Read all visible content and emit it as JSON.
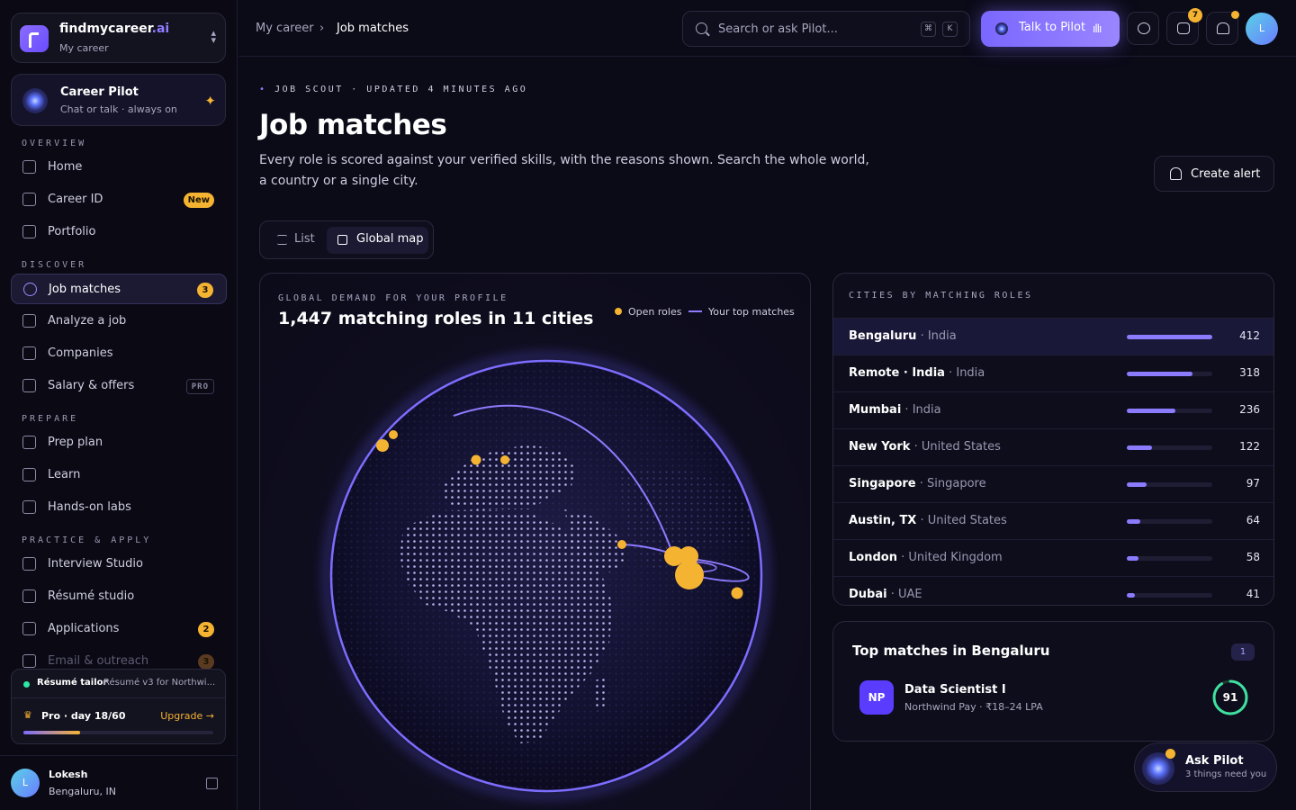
{
  "brand": {
    "name": "findmycareer",
    "suffix": ".ai",
    "subtitle": "My career"
  },
  "pilot_card": {
    "title": "Career Pilot",
    "subtitle": "Chat or talk · always on"
  },
  "sidebar": {
    "sections": [
      {
        "label": "OVERVIEW",
        "items": [
          {
            "label": "Home",
            "icon": "home-icon"
          },
          {
            "label": "Career ID",
            "icon": "id-card-icon",
            "badge": "New"
          },
          {
            "label": "Portfolio",
            "icon": "portfolio-icon"
          }
        ]
      },
      {
        "label": "DISCOVER",
        "items": [
          {
            "label": "Job matches",
            "icon": "target-icon",
            "badge": "3",
            "active": true
          },
          {
            "label": "Analyze a job",
            "icon": "scan-icon"
          },
          {
            "label": "Companies",
            "icon": "building-icon"
          },
          {
            "label": "Salary & offers",
            "icon": "rupee-icon",
            "badge": "PRO"
          }
        ]
      },
      {
        "label": "PREPARE",
        "items": [
          {
            "label": "Prep plan",
            "icon": "route-icon"
          },
          {
            "label": "Learn",
            "icon": "book-icon"
          },
          {
            "label": "Hands-on labs",
            "icon": "flask-icon"
          }
        ]
      },
      {
        "label": "PRACTICE & APPLY",
        "items": [
          {
            "label": "Interview Studio",
            "icon": "mic-icon"
          },
          {
            "label": "Résumé studio",
            "icon": "document-icon"
          },
          {
            "label": "Applications",
            "icon": "kanban-icon",
            "badge": "2"
          },
          {
            "label": "Email & outreach",
            "icon": "mail-icon",
            "badge": "3"
          }
        ]
      }
    ]
  },
  "status_card": {
    "task": "Résumé tailor",
    "detail": "Résumé v3 for Northwi...",
    "plan": "Pro · day 18/60",
    "upgrade": "Upgrade →",
    "progress": 0.3
  },
  "user": {
    "initial": "L",
    "name": "Lokesh",
    "location": "Bengaluru, IN"
  },
  "header": {
    "crumbs": [
      "My career",
      "Job matches"
    ],
    "search_placeholder": "Search or ask Pilot...",
    "kbd": [
      "⌘",
      "K"
    ],
    "talk_label": "Talk to Pilot",
    "messages_badge": "7",
    "avatar_initial": "L"
  },
  "page": {
    "eyebrow": "JOB SCOUT · UPDATED 4 MINUTES AGO",
    "title": "Job matches",
    "description": "Every role is scored against your verified skills, with the reasons shown. Search the whole world, a country or a single city.",
    "create_alert": "Create alert",
    "view_toggle": {
      "list": "List",
      "map": "Global map",
      "selected": "map"
    }
  },
  "globe": {
    "eyebrow": "GLOBAL DEMAND FOR YOUR PROFILE",
    "title": "1,447 matching roles in 11 cities",
    "legend": {
      "open_roles": "Open roles",
      "top_matches": "Your top matches"
    },
    "colors": {
      "open": "#f5b332",
      "arc": "#8f7bff"
    }
  },
  "cities": {
    "eyebrow": "CITIES BY MATCHING ROLES",
    "max": 412,
    "rows": [
      {
        "city": "Bengaluru",
        "country": "India",
        "count": 412,
        "active": true
      },
      {
        "city": "Remote · India",
        "country": "India",
        "count": 318
      },
      {
        "city": "Mumbai",
        "country": "India",
        "count": 236
      },
      {
        "city": "New York",
        "country": "United States",
        "count": 122
      },
      {
        "city": "Singapore",
        "country": "Singapore",
        "count": 97
      },
      {
        "city": "Austin, TX",
        "country": "United States",
        "count": 64
      },
      {
        "city": "London",
        "country": "United Kingdom",
        "count": 58
      },
      {
        "city": "Dubai",
        "country": "UAE",
        "count": 41
      }
    ]
  },
  "top_matches": {
    "title": "Top matches in Bengaluru",
    "count": "1",
    "jobs": [
      {
        "logo": "NP",
        "title": "Data Scientist I",
        "meta": "Northwind Pay · ₹18–24 LPA",
        "score": 91
      }
    ]
  },
  "ask_pilot": {
    "title": "Ask Pilot",
    "subtitle": "3 things need you"
  }
}
